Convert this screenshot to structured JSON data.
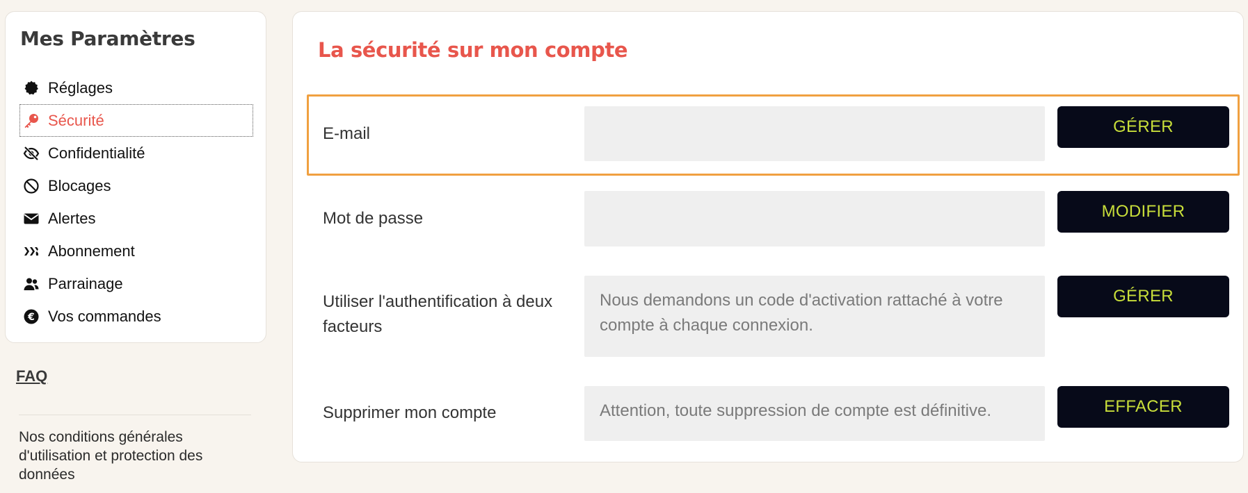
{
  "sidebar": {
    "title": "Mes Paramètres",
    "items": [
      {
        "label": "Réglages",
        "icon": "gear-icon"
      },
      {
        "label": "Sécurité",
        "icon": "key-icon",
        "active": true
      },
      {
        "label": "Confidentialité",
        "icon": "eye-slash-icon"
      },
      {
        "label": "Blocages",
        "icon": "ban-icon"
      },
      {
        "label": "Alertes",
        "icon": "envelope-icon"
      },
      {
        "label": "Abonnement",
        "icon": "brand-logo-icon"
      },
      {
        "label": "Parrainage",
        "icon": "users-icon"
      },
      {
        "label": "Vos commandes",
        "icon": "euro-icon"
      }
    ],
    "faq": "FAQ",
    "conditions": "Nos conditions générales d'utilisation et protection des données"
  },
  "main": {
    "title": "La sécurité sur mon compte",
    "rows": [
      {
        "label": "E-mail",
        "field_text": "",
        "button": "GÉRER",
        "highlighted": true
      },
      {
        "label": "Mot de passe",
        "field_text": "",
        "button": "MODIFIER"
      },
      {
        "label": "Utiliser l'authentification à deux facteurs",
        "field_text": "Nous demandons un code d'activation rattaché à votre compte à chaque connexion.",
        "button": "GÉRER"
      },
      {
        "label": "Supprimer mon compte",
        "field_text": "Attention, toute suppression de compte est définitive.",
        "button": "EFFACER"
      }
    ]
  },
  "colors": {
    "accent": "#e8564c",
    "button_bg": "#070a19",
    "button_text": "#c8de3a",
    "highlight_border": "#f0a040",
    "page_bg": "#f8f4ee"
  }
}
